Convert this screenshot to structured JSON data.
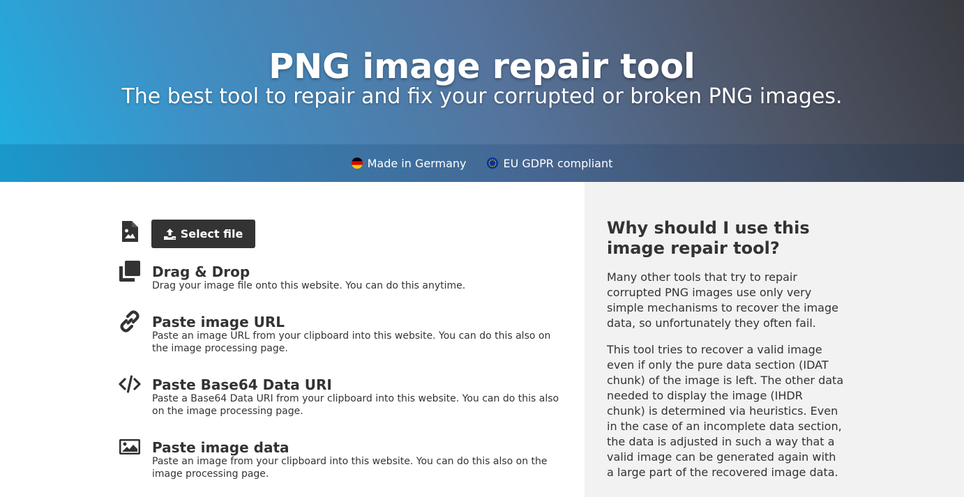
{
  "hero": {
    "title": "PNG image repair tool",
    "subtitle": "The best tool to repair and fix your corrupted or broken PNG images."
  },
  "badges": [
    {
      "label": "Made in Germany",
      "icon": "germany-flag-icon"
    },
    {
      "label": "EU GDPR compliant",
      "icon": "eu-flag-icon"
    }
  ],
  "upload": {
    "select_label": "Select file",
    "options": [
      {
        "title": "Drag & Drop",
        "desc": "Drag your image file onto this website. You can do this anytime.",
        "icon": "copy-icon"
      },
      {
        "title": "Paste image URL",
        "desc": "Paste an image URL from your clipboard into this website. You can do this also on the image processing page.",
        "icon": "link-icon"
      },
      {
        "title": "Paste Base64 Data URI",
        "desc": "Paste a Base64 Data URI from your clipboard into this website. You can do this also on the image processing page.",
        "icon": "code-icon"
      },
      {
        "title": "Paste image data",
        "desc": "Paste an image from your clipboard into this website. You can do this also on the image processing page.",
        "icon": "image-icon"
      }
    ]
  },
  "why": {
    "title": "Why should I use this image repair tool?",
    "paragraphs": [
      "Many other tools that try to repair corrupted PNG images use only very simple mechanisms to recover the image data, so unfortunately they often fail.",
      "This tool tries to recover a valid image even if only the pure data section (IDAT chunk) of the image is left. The other data needed to display the image (IHDR chunk) is determined via heuristics. Even in the case of an incomplete data section, the data is adjusted in such a way that a valid image can be generated again with a large part of the recovered image data."
    ]
  },
  "colors": {
    "button_bg": "#333333",
    "sidebar_bg": "#f2f2f2",
    "hero_gradient_start": "#1eb0e3",
    "hero_gradient_end": "#393a40"
  }
}
